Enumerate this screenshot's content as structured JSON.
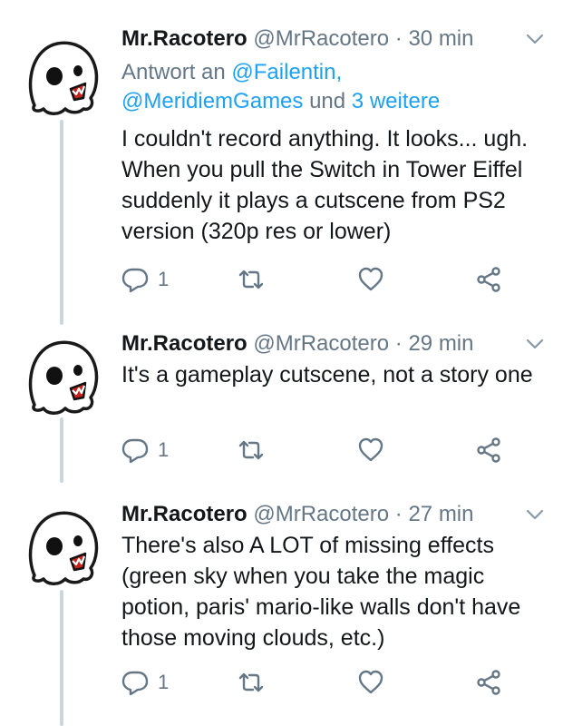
{
  "tweets": [
    {
      "name": "Mr.Racotero",
      "handle": "@MrRacotero",
      "time": "30 min",
      "reply_prefix": "Antwort an ",
      "reply_line1": "@Failentin,",
      "reply_line2_link": "@MeridiemGames",
      "reply_line2_mid": " und ",
      "reply_line2_more": "3 weitere",
      "text": "I couldn't record anything. It looks... ugh.\nWhen you pull the Switch in Tower Eiffel\nsuddenly it plays a cutscene from PS2\nversion (320p res or lower)",
      "reply_count": "1"
    },
    {
      "name": "Mr.Racotero",
      "handle": "@MrRacotero",
      "time": "29 min",
      "text": "It's a gameplay cutscene, not a story one",
      "reply_count": "1"
    },
    {
      "name": "Mr.Racotero",
      "handle": "@MrRacotero",
      "time": "27 min",
      "text": "There's also A LOT of missing effects\n(green sky when you take the magic\npotion, paris' mario-like walls don't have\nthose moving clouds, etc.)",
      "reply_count": "1"
    }
  ],
  "separator": "·",
  "icons": {
    "avatar": "ghost-skull-avatar",
    "more": "chevron-down-icon",
    "reply": "reply-bubble-icon",
    "retweet": "retweet-icon",
    "like": "heart-icon",
    "share": "share-icon"
  },
  "colors": {
    "link": "#1da1f2",
    "muted": "#657786",
    "text": "#14171a",
    "thread": "#ccd6dd"
  }
}
